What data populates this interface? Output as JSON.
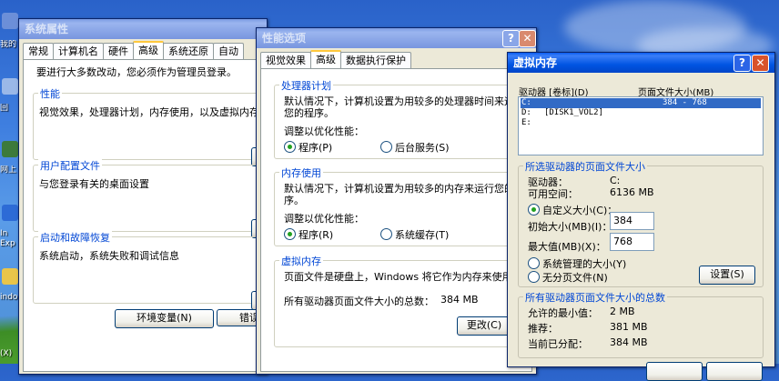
{
  "desktop": {
    "labels": [
      "我的",
      "回",
      "网上",
      "In",
      "Exp",
      "indo",
      "(X)"
    ]
  },
  "system_properties": {
    "title": "系统属性",
    "tabs": [
      "常规",
      "计算机名",
      "硬件",
      "高级",
      "系统还原",
      "自动"
    ],
    "admin_note": "要进行大多数改动，您必须作为管理员登录。",
    "performance": {
      "label": "性能",
      "text": "视觉效果，处理器计划，内存使用，以及虚拟内存"
    },
    "user_profiles": {
      "label": "用户配置文件",
      "text": "与您登录有关的桌面设置"
    },
    "startup": {
      "label": "启动和故障恢复",
      "text": "系统启动，系统失败和调试信息"
    },
    "env_button": "环境变量(N)",
    "error_button": "错误"
  },
  "performance_options": {
    "title": "性能选项",
    "tabs": [
      "视觉效果",
      "高级",
      "数据执行保护"
    ],
    "cpu": {
      "label": "处理器计划",
      "text1": "默认情况下，计算机设置为用较多的处理器时间来运行",
      "text2": "您的程序。",
      "adjust": "调整以优化性能：",
      "opt1": "程序(P)",
      "opt2": "后台服务(S)"
    },
    "memory": {
      "label": "内存使用",
      "text1": "默认情况下，计算机设置为用较多的内存来运行您的程",
      "text2": "序。",
      "adjust": "调整以优化性能：",
      "opt1": "程序(R)",
      "opt2": "系统缓存(T)"
    },
    "vm": {
      "label": "虚拟内存",
      "text": "页面文件是硬盘上，Windows 将它作为内存来使用。",
      "total_label": "所有驱动器页面文件大小的总数：",
      "total_value": "384 MB",
      "change_button": "更改(C)"
    }
  },
  "virtual_memory": {
    "title": "虚拟内存",
    "col_drive": "驱动器 [卷标](D)",
    "col_size": "页面文件大小(MB)",
    "drives": [
      {
        "drive": "C:",
        "label": "",
        "size": "384 - 768",
        "selected": true
      },
      {
        "drive": "D:",
        "label": "[DISK1_VOL2]",
        "size": "",
        "selected": false
      },
      {
        "drive": "E:",
        "label": "",
        "size": "",
        "selected": false
      }
    ],
    "selected_group": {
      "label": "所选驱动器的页面文件大小",
      "drive_label": "驱动器：",
      "drive_value": "C:",
      "free_label": "可用空间：",
      "free_value": "6136 MB",
      "custom": "自定义大小(C)：",
      "initial_label": "初始大小(MB)(I)：",
      "initial_value": "384",
      "max_label": "最大值(MB)(X)：",
      "max_value": "768",
      "system_managed": "系统管理的大小(Y)",
      "no_paging": "无分页文件(N)",
      "set_button": "设置(S)"
    },
    "total_group": {
      "label": "所有驱动器页面文件大小的总数",
      "min_label": "允许的最小值：",
      "min_value": "2 MB",
      "rec_label": "推荐：",
      "rec_value": "381 MB",
      "cur_label": "当前已分配：",
      "cur_value": "384 MB"
    }
  }
}
